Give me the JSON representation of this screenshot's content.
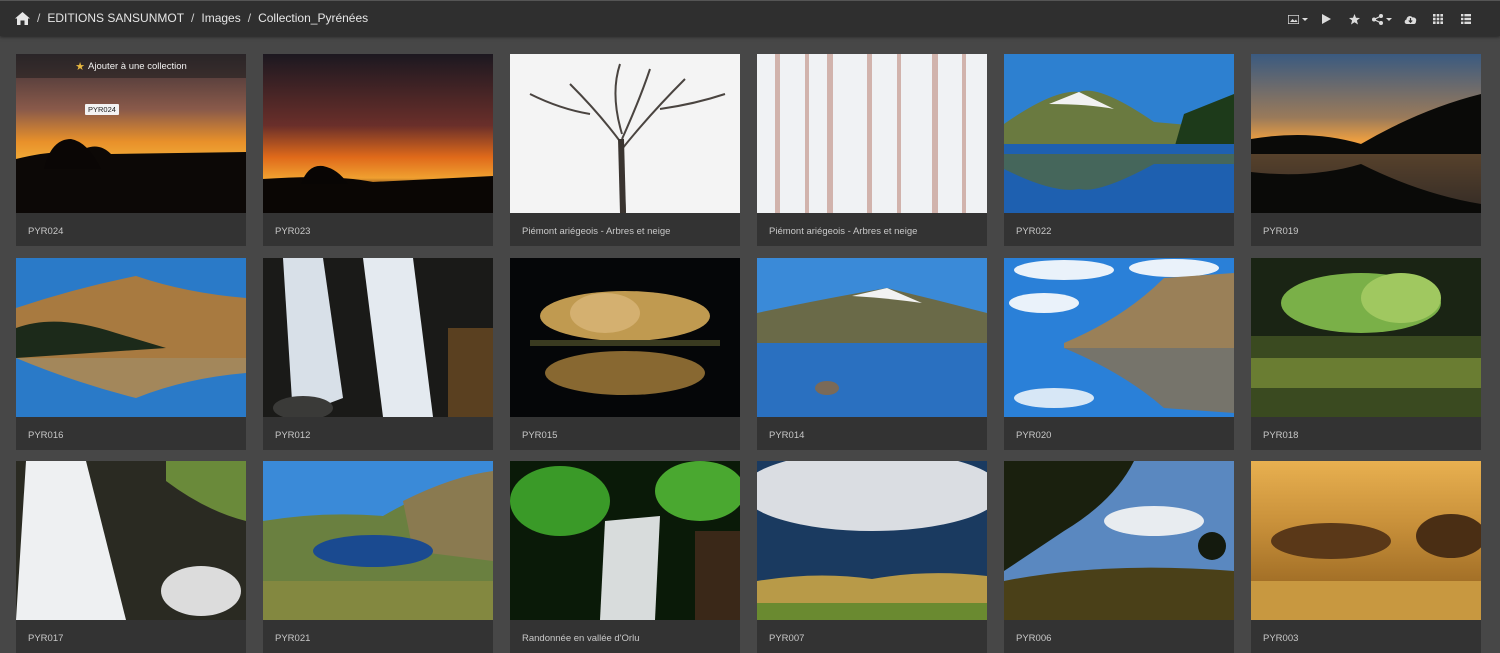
{
  "breadcrumb": {
    "home_icon": "home-icon",
    "items": [
      "EDITIONS SANSUNMOT",
      "Images",
      "Collection_Pyrénées"
    ],
    "separator": "/"
  },
  "toolbar": {
    "icons": [
      "image-size-icon",
      "play-icon",
      "star-icon",
      "share-icon",
      "download-icon",
      "grid-small-icon",
      "list-icon"
    ]
  },
  "hover_card": {
    "add_to_collection": "Ajouter à une collection",
    "tooltip": "PYR024"
  },
  "cards": [
    {
      "label": "PYR024"
    },
    {
      "label": "PYR023"
    },
    {
      "label": "Piémont ariégeois - Arbres et neige"
    },
    {
      "label": "Piémont ariégeois - Arbres et neige"
    },
    {
      "label": "PYR022"
    },
    {
      "label": "PYR019"
    },
    {
      "label": "PYR016"
    },
    {
      "label": "PYR012"
    },
    {
      "label": "PYR015"
    },
    {
      "label": "PYR014"
    },
    {
      "label": "PYR020"
    },
    {
      "label": "PYR018"
    },
    {
      "label": "PYR017"
    },
    {
      "label": "PYR021"
    },
    {
      "label": "Randonnée en vallée d'Orlu"
    },
    {
      "label": "PYR007"
    },
    {
      "label": "PYR006"
    },
    {
      "label": "PYR003"
    }
  ]
}
